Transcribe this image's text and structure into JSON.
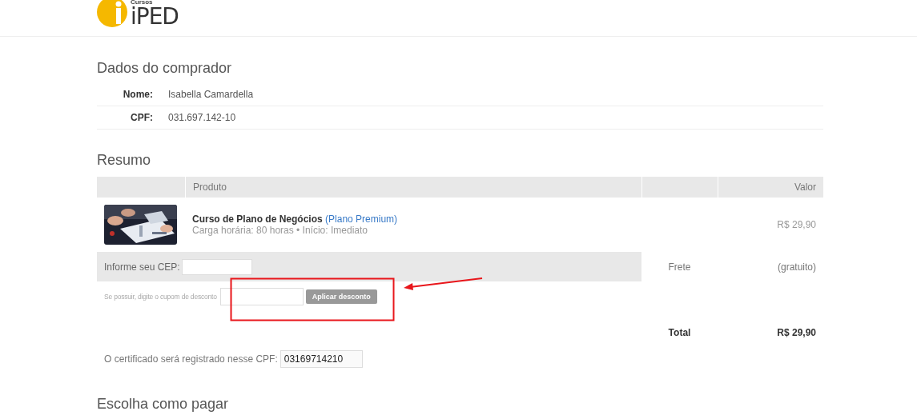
{
  "logo": {
    "tagline": "Cursos",
    "name": "iPED"
  },
  "buyer": {
    "title": "Dados do comprador",
    "fields": [
      {
        "label": "Nome:",
        "value": "Isabella Camardella"
      },
      {
        "label": "CPF:",
        "value": "031.697.142-10"
      }
    ]
  },
  "summary": {
    "title": "Resumo",
    "columns": [
      {
        "label": "Produto"
      },
      {
        "label": "Valor"
      }
    ],
    "product": {
      "name": "Curso de Plano de Negócios",
      "plan": "(Plano Premium)",
      "details": "Carga horária: 80 horas • Início: Imediato",
      "price": "R$ 29,90"
    },
    "cep": {
      "label": "Informe seu CEP:"
    },
    "shipping": {
      "label": "Frete",
      "value": "(gratuito)"
    },
    "coupon": {
      "label": "Se possuir, digite o cupom de desconto",
      "button": "Aplicar desconto"
    },
    "total": {
      "label": "Total",
      "value": "R$ 29,90"
    }
  },
  "certificate": {
    "label": "O certificado será registrado nesse CPF:",
    "value": "03169714210"
  },
  "payment": {
    "title": "Escolha como pagar"
  }
}
